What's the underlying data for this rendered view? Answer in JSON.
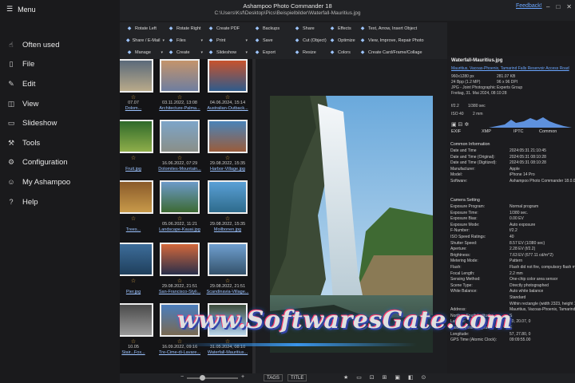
{
  "window": {
    "title": "Ashampoo Photo Commander 18",
    "path": "C:\\Users\\Ksf\\Desktop\\Pics\\Beispielbilder\\Waterfall-Mauritius.jpg",
    "feedback": "Feedback!"
  },
  "menu": {
    "header": "Menu",
    "items": [
      {
        "label": "Often used",
        "icon": "thumbs-up-icon"
      },
      {
        "label": "File",
        "icon": "file-icon"
      },
      {
        "label": "Edit",
        "icon": "pencil-icon"
      },
      {
        "label": "View",
        "icon": "view-icon"
      },
      {
        "label": "Slideshow",
        "icon": "slideshow-icon"
      },
      {
        "label": "Tools",
        "icon": "tools-icon"
      },
      {
        "label": "Configuration",
        "icon": "gear-icon"
      },
      {
        "label": "My Ashampoo",
        "icon": "user-icon"
      },
      {
        "label": "Help",
        "icon": "help-icon"
      }
    ]
  },
  "toolbar": {
    "col1": [
      "Rotate Left",
      "Share / E-Mail",
      "Manage"
    ],
    "col2": [
      "Rotate Right",
      "Files",
      "Create"
    ],
    "col3": [
      "Create PDF",
      "Print",
      "Slideshow"
    ],
    "col4": [
      "Backups",
      "Save",
      "Export"
    ],
    "col5": [
      "Share",
      "Cut (Object)",
      "Resize"
    ],
    "col6": [
      "Effects",
      "Optimize",
      "Colors"
    ],
    "col7": [
      "Text, Arrow, Insert Object",
      "View, Improve, Repair Photo",
      "Create Card/Frame/Collage"
    ]
  },
  "thumbnails": [
    {
      "date": "07.07",
      "name": "Dolom...",
      "colors": [
        "#5b6a7a",
        "#b9aa8a"
      ]
    },
    {
      "date": "03.11.2022, 13:08",
      "name": "Architecture-Palma...",
      "colors": [
        "#c4946b",
        "#6e7ea0"
      ]
    },
    {
      "date": "04.06.2024, 15:14",
      "name": "Australian-Outback...",
      "colors": [
        "#c7532d",
        "#2f5b8c"
      ]
    },
    {
      "date": "",
      "name": "Fruit.jpg",
      "colors": [
        "#2f6a2a",
        "#8fae4a"
      ]
    },
    {
      "date": "16.06.2022, 07:29",
      "name": "Dolomites-Mountain...",
      "colors": [
        "#7da5c9",
        "#8a8f88"
      ]
    },
    {
      "date": "29.08.2022, 15:35",
      "name": "Harbor-Village.jpg",
      "colors": [
        "#4b84b8",
        "#9a5c3b"
      ]
    },
    {
      "date": "",
      "name": "Trees...",
      "colors": [
        "#8a5a2a",
        "#c89a4a"
      ]
    },
    {
      "date": "05.06.2022, 11:21",
      "name": "Landscape-Kauai.jpg",
      "colors": [
        "#6c9ac9",
        "#3d6a33"
      ]
    },
    {
      "date": "29.08.2022, 15:35",
      "name": "Moilbonen.jpg",
      "colors": [
        "#5aa0d6",
        "#2e6b8c"
      ]
    },
    {
      "date": "",
      "name": "Pier.jpg",
      "colors": [
        "#3d6d9a",
        "#1f3f5c"
      ]
    },
    {
      "date": "29.08.2022, 21:51",
      "name": "San-Francisco-Styli...",
      "colors": [
        "#d4683b",
        "#2a2f4a"
      ]
    },
    {
      "date": "29.08.2022, 21:51",
      "name": "Scandinavia-Village...",
      "colors": [
        "#6f9fd0",
        "#34526b"
      ]
    },
    {
      "date": "10.05",
      "name": "Stair...Fox...",
      "colors": [
        "#4a4a4a",
        "#9a9a9a"
      ]
    },
    {
      "date": "16.09.2022, 09:16",
      "name": "Tre-Cime-di-Lavare...",
      "colors": [
        "#4b7ebd",
        "#7a6a52"
      ]
    },
    {
      "date": "31.05.2024, 08:10",
      "name": "Waterfall-Mauritius...",
      "colors": [
        "#3a4a3a",
        "#b9d4e8"
      ]
    }
  ],
  "info": {
    "filename": "Waterfall-Mauritius.jpg",
    "location": "Mauritius, Vacoas-Phoenix, Tamarind Falls Reservoir Access Road",
    "dims": "960x1280 px",
    "filesize": "281.07 KB",
    "bits": "24 Bpp (1.2 MP)",
    "dpi": "96 x 96 DPI",
    "format": "JPG - Joint Photographic Experts Group",
    "date": "Freitag, 31. Mai 2024, 08:10:28",
    "aperture": "f/2.2",
    "shutter": "1/380 sec",
    "iso": "ISO 40",
    "focal": "2 mm",
    "tabs": [
      "EXIF",
      "XMP",
      "IPTC",
      "Common"
    ],
    "section_common": "Common Information",
    "section_camera": "Camera Setting",
    "rows_common": [
      {
        "k": "Date and Time",
        "v": "2024:05:31 21:10:45"
      },
      {
        "k": "Date and Time (Original):",
        "v": "2024:05:31 08:10:28"
      },
      {
        "k": "Date and Time (Digitized):",
        "v": "2024:05:31 08:10:28"
      },
      {
        "k": "Manufacturer:",
        "v": "Apple"
      },
      {
        "k": "Model:",
        "v": "iPhone 14 Pro"
      },
      {
        "k": "Software:",
        "v": "Ashampoo Photo Commander 18.0.0"
      }
    ],
    "rows_camera": [
      {
        "k": "Exposure Program:",
        "v": "Normal program"
      },
      {
        "k": "Exposure Time:",
        "v": "1/380 sec."
      },
      {
        "k": "Exposure Bias:",
        "v": "0.00 EV"
      },
      {
        "k": "Exposure Mode:",
        "v": "Auto exposure"
      },
      {
        "k": "F-Number:",
        "v": "f/2.2"
      },
      {
        "k": "ISO Speed Ratings:",
        "v": "40"
      },
      {
        "k": "Shutter Speed:",
        "v": "8.57 EV (1/380 sec)"
      },
      {
        "k": "Aperture:",
        "v": "2.28 EV (f/2.2)"
      },
      {
        "k": "Brightness:",
        "v": "7.63 EV (677.11 cd/m^2)"
      },
      {
        "k": "Metering Mode:",
        "v": "Pattern"
      },
      {
        "k": "Flash:",
        "v": "Flash did not fire, compulsory flash mode"
      },
      {
        "k": "Focal Length:",
        "v": "2.2 mm"
      },
      {
        "k": "Sensing Method:",
        "v": "One-chip color area sensor"
      },
      {
        "k": "Scene Type:",
        "v": "Directly photographed"
      },
      {
        "k": "White Balance:",
        "v": "Auto white balance"
      },
      {
        "k": "",
        "v": "Standard"
      },
      {
        "k": "",
        "v": "Within rectangle (width 2323, height 1307)"
      },
      {
        "k": "Address:",
        "v": "Mauritius, Vacoas-Phoenix, Tamarind Falls Reservoir"
      },
      {
        "k": "North or South Latitude:",
        "v": "S"
      },
      {
        "k": "Latitude:",
        "v": "20, 20.07, 0"
      },
      {
        "k": "East or West Longitude:",
        "v": "E"
      },
      {
        "k": "Longitude:",
        "v": "57, 27.80, 0"
      },
      {
        "k": "GPS Time (Atomic Clock):",
        "v": "09:09:55.00"
      }
    ]
  },
  "status": {
    "tags": "TAGS",
    "title": "TITLE"
  },
  "watermark": "www.SoftwaresGate.com",
  "colors": {
    "accent": "#6aa6ff",
    "star": "#e8b04b",
    "background": "#1b1b1d"
  }
}
